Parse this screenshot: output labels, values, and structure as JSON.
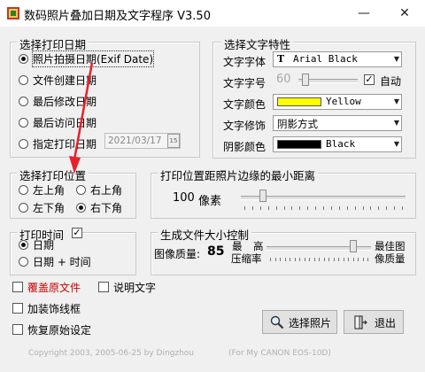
{
  "window": {
    "title": "数码照片叠加日期及文字程序  V3.50",
    "minimize": "—",
    "close": "✕"
  },
  "date_group": {
    "legend": "选择打印日期",
    "options": [
      "照片拍摄日期(Exif Date)",
      "文件创建日期",
      "最后修改日期",
      "最后访问日期",
      "指定打印日期"
    ],
    "selected": 0,
    "date_value": "2021/03/17",
    "date_button": "15"
  },
  "text_group": {
    "legend": "选择文字特性",
    "font_label": "文字字体",
    "font_value": "Arial Black",
    "size_label": "文字字号",
    "size_value": "60",
    "auto_label": "自动",
    "auto_checked": true,
    "color_label": "文字颜色",
    "color_value": "Yellow",
    "color_swatch": "#ffff00",
    "decoration_label": "文字修饰",
    "decoration_value": "阴影方式",
    "shadow_label": "阴影颜色",
    "shadow_value": "Black",
    "shadow_swatch": "#000000"
  },
  "position_group": {
    "legend": "选择打印位置",
    "options": [
      "左上角",
      "右上角",
      "左下角",
      "右下角"
    ],
    "selected": 3
  },
  "distance_group": {
    "legend": "打印位置距照片边缘的最小距离",
    "value": "100",
    "unit": "像素",
    "slider_level": 0.12
  },
  "time_group": {
    "legend": "打印时间",
    "checked": true,
    "options": [
      "日期",
      "日期 + 时间"
    ],
    "selected": 0
  },
  "size_group": {
    "legend": "生成文件大小控制",
    "quality_label": "图像质量:",
    "quality_value": "85",
    "low_label_1": "最",
    "low_label_2": "压缩率",
    "high_label_1": "高",
    "best_label_1": "最佳图",
    "best_label_2": "像质量",
    "slider_level": 0.85
  },
  "options": {
    "overwrite": "覆盖原文件",
    "overwrite_color": "#cc0000",
    "caption": "说明文字",
    "border": "加装饰线框",
    "restore": "恢复原始设定"
  },
  "buttons": {
    "select_photo": "选择照片",
    "exit": "退出"
  },
  "footer": {
    "copyright": "Copyright 2003, 2005-06-25 by Dingzhou",
    "camera": "(For My CANON EOS-10D)"
  },
  "colors": {
    "arrow": "#e8202a"
  }
}
